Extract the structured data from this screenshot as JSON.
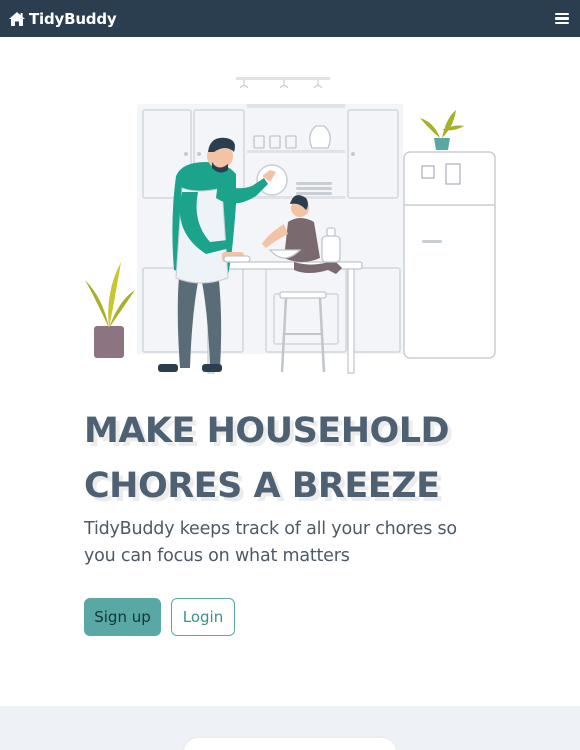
{
  "navbar": {
    "brand_name": "TidyBuddy",
    "brand_icon": "home-icon",
    "menu_icon": "hamburger-menu-icon",
    "background_color": "#2b3e4f"
  },
  "hero": {
    "illustration": "kitchen-cooking-illustration",
    "title_line1": "MAKE HOUSEHOLD",
    "title_line2": "CHORES A BREEZE",
    "subtitle_line1": "TidyBuddy keeps track of all your chores so",
    "subtitle_line2": "you can focus on what matters",
    "signup_label": "Sign up",
    "login_label": "Login",
    "accent_color": "#5aa8a5",
    "title_color": "#4d6173"
  },
  "section2": {
    "background_color": "#eef1f5"
  }
}
